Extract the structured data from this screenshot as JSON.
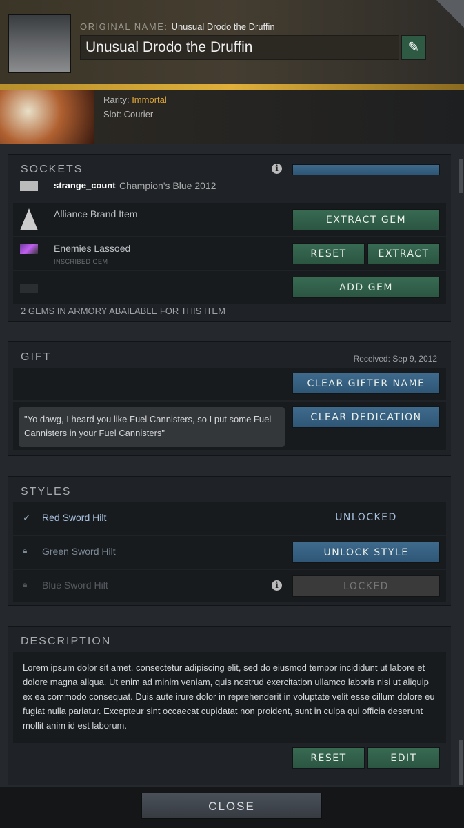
{
  "header": {
    "original_name_label": "ORIGINAL NAME:",
    "original_name": "Unusual Drodo the Druffin",
    "name_value": "Unusual Drodo the Druffin",
    "edit_icon": "pencil-icon",
    "rarity_label": "Rarity:",
    "rarity": "Immortal",
    "rarity_color": "#e0a93a",
    "slot": "Slot: Courier"
  },
  "sockets": {
    "title": "SOCKETS",
    "top_gem": {
      "name": "strange_count",
      "value": "Champion's Blue 2012"
    },
    "rows": [
      {
        "name": "Alliance Brand Item",
        "buttons": [
          "EXTRACT GEM"
        ]
      },
      {
        "name": "Enemies Lassoed",
        "sub": "INSCRIBED GEM",
        "buttons": [
          "RESET",
          "EXTRACT"
        ]
      },
      {
        "name": "",
        "buttons": [
          "ADD GEM"
        ]
      }
    ],
    "footer": "2 GEMS IN ARMORY ABAILABLE FOR THIS ITEM"
  },
  "gift": {
    "title": "GIFT",
    "received": "Received: Sep 9, 2012",
    "clear_gifter": "CLEAR GIFTER NAME",
    "clear_dedication": "CLEAR DEDICATION",
    "dedication": "\"Yo dawg, I heard you like Fuel Cannisters, so I put some Fuel Cannisters in your Fuel Cannisters\""
  },
  "styles": {
    "title": "STYLES",
    "items": [
      {
        "name": "Red Sword Hilt",
        "status": "UNLOCKED",
        "icon": "check-icon"
      },
      {
        "name": "Green Sword Hilt",
        "status": "UNLOCK STYLE",
        "icon": "lock-icon"
      },
      {
        "name": "Blue Sword Hilt",
        "status": "LOCKED",
        "icon": "lock-icon"
      }
    ]
  },
  "description": {
    "title": "DESCRIPTION",
    "text": "Lorem ipsum dolor sit amet, consectetur adipiscing elit, sed do eiusmod tempor incididunt ut labore et dolore magna aliqua. Ut enim ad minim veniam, quis nostrud exercitation ullamco laboris nisi ut aliquip ex ea commodo consequat. Duis aute irure dolor in reprehenderit in voluptate velit esse cillum dolore eu fugiat nulla pariatur. Excepteur sint occaecat cupidatat non proident, sunt in culpa qui officia deserunt mollit anim id est laborum.",
    "reset": "RESET",
    "edit": "EDIT"
  },
  "footer": {
    "close": "CLOSE"
  }
}
